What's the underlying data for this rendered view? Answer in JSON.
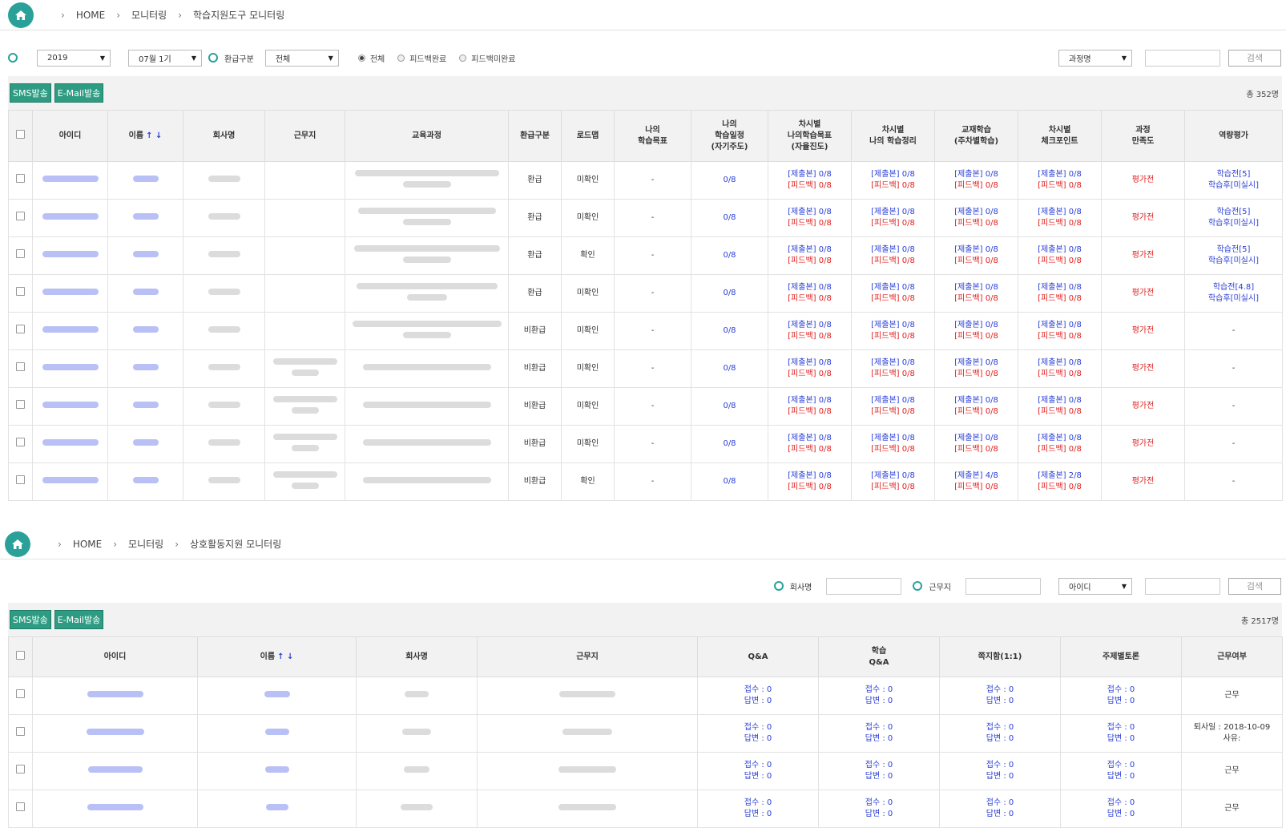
{
  "section1": {
    "breadcrumb": [
      "HOME",
      "모니터링",
      "학습지원도구 모니터링"
    ],
    "filters": {
      "year": "2019",
      "period": "07월 1기",
      "refund_label": "환급구분",
      "refund_value": "전체",
      "radios": [
        "전체",
        "피드백완료",
        "피드백미완료"
      ],
      "search_field": "과정명",
      "search_button": "검색"
    },
    "buttons": {
      "sms": "SMS발송",
      "email": "E-Mail발송"
    },
    "total": "총 352명",
    "columns": [
      "아이디",
      "이름",
      "회사명",
      "근무지",
      "교육과정",
      "환급구분",
      "로드맵",
      "나의\n학습목표",
      "나의\n학습일정\n(자기주도)",
      "차시별\n나의학습목표\n(자율진도)",
      "차시별\n나의 학습정리",
      "교재학습\n(주차별학습)",
      "차시별\n체크포인트",
      "과정\n만족도",
      "역량평가"
    ],
    "sort_icons": "↑ ↓",
    "rows": [
      {
        "refund": "환급",
        "roadmap": "미확인",
        "goal": "-",
        "schedule": "0/8",
        "c1": [
          "[제출본] 0/8",
          "[피드백] 0/8"
        ],
        "c2": [
          "[제출본] 0/8",
          "[피드백] 0/8"
        ],
        "c3": [
          "[제출본] 0/8",
          "[피드백] 0/8"
        ],
        "c4": [
          "[제출본] 0/8",
          "[피드백] 0/8"
        ],
        "satisfaction": "평가전",
        "eval": [
          "학습전[5]",
          "학습후[미실시]"
        ]
      },
      {
        "refund": "환급",
        "roadmap": "미확인",
        "goal": "-",
        "schedule": "0/8",
        "c1": [
          "[제출본] 0/8",
          "[피드백] 0/8"
        ],
        "c2": [
          "[제출본] 0/8",
          "[피드백] 0/8"
        ],
        "c3": [
          "[제출본] 0/8",
          "[피드백] 0/8"
        ],
        "c4": [
          "[제출본] 0/8",
          "[피드백] 0/8"
        ],
        "satisfaction": "평가전",
        "eval": [
          "학습전[5]",
          "학습후[미실시]"
        ]
      },
      {
        "refund": "환급",
        "roadmap": "확인",
        "goal": "-",
        "schedule": "0/8",
        "c1": [
          "[제출본] 0/8",
          "[피드백] 0/8"
        ],
        "c2": [
          "[제출본] 0/8",
          "[피드백] 0/8"
        ],
        "c3": [
          "[제출본] 0/8",
          "[피드백] 0/8"
        ],
        "c4": [
          "[제출본] 0/8",
          "[피드백] 0/8"
        ],
        "satisfaction": "평가전",
        "eval": [
          "학습전[5]",
          "학습후[미실시]"
        ]
      },
      {
        "refund": "환급",
        "roadmap": "미확인",
        "goal": "-",
        "schedule": "0/8",
        "c1": [
          "[제출본] 0/8",
          "[피드백] 0/8"
        ],
        "c2": [
          "[제출본] 0/8",
          "[피드백] 0/8"
        ],
        "c3": [
          "[제출본] 0/8",
          "[피드백] 0/8"
        ],
        "c4": [
          "[제출본] 0/8",
          "[피드백] 0/8"
        ],
        "satisfaction": "평가전",
        "eval": [
          "학습전[4.8]",
          "학습후[미실시]"
        ]
      },
      {
        "refund": "비환급",
        "roadmap": "미확인",
        "goal": "-",
        "schedule": "0/8",
        "c1": [
          "[제출본] 0/8",
          "[피드백] 0/8"
        ],
        "c2": [
          "[제출본] 0/8",
          "[피드백] 0/8"
        ],
        "c3": [
          "[제출본] 0/8",
          "[피드백] 0/8"
        ],
        "c4": [
          "[제출본] 0/8",
          "[피드백] 0/8"
        ],
        "satisfaction": "평가전",
        "eval": [
          "-"
        ]
      },
      {
        "refund": "비환급",
        "roadmap": "미확인",
        "goal": "-",
        "schedule": "0/8",
        "c1": [
          "[제출본] 0/8",
          "[피드백] 0/8"
        ],
        "c2": [
          "[제출본] 0/8",
          "[피드백] 0/8"
        ],
        "c3": [
          "[제출본] 0/8",
          "[피드백] 0/8"
        ],
        "c4": [
          "[제출본] 0/8",
          "[피드백] 0/8"
        ],
        "satisfaction": "평가전",
        "eval": [
          "-"
        ]
      },
      {
        "refund": "비환급",
        "roadmap": "미확인",
        "goal": "-",
        "schedule": "0/8",
        "c1": [
          "[제출본] 0/8",
          "[피드백] 0/8"
        ],
        "c2": [
          "[제출본] 0/8",
          "[피드백] 0/8"
        ],
        "c3": [
          "[제출본] 0/8",
          "[피드백] 0/8"
        ],
        "c4": [
          "[제출본] 0/8",
          "[피드백] 0/8"
        ],
        "satisfaction": "평가전",
        "eval": [
          "-"
        ]
      },
      {
        "refund": "비환급",
        "roadmap": "미확인",
        "goal": "-",
        "schedule": "0/8",
        "c1": [
          "[제출본] 0/8",
          "[피드백] 0/8"
        ],
        "c2": [
          "[제출본] 0/8",
          "[피드백] 0/8"
        ],
        "c3": [
          "[제출본] 0/8",
          "[피드백] 0/8"
        ],
        "c4": [
          "[제출본] 0/8",
          "[피드백] 0/8"
        ],
        "satisfaction": "평가전",
        "eval": [
          "-"
        ]
      },
      {
        "refund": "비환급",
        "roadmap": "확인",
        "goal": "-",
        "schedule": "0/8",
        "c1": [
          "[제출본] 0/8",
          "[피드백] 0/8"
        ],
        "c2": [
          "[제출본] 0/8",
          "[피드백] 0/8"
        ],
        "c3": [
          "[제출본] 4/8",
          "[피드백] 0/8"
        ],
        "c4": [
          "[제출본] 2/8",
          "[피드백] 0/8"
        ],
        "satisfaction": "평가전",
        "eval": [
          "-"
        ]
      }
    ]
  },
  "section2": {
    "breadcrumb": [
      "HOME",
      "모니터링",
      "상호활동지원 모니터링"
    ],
    "filters": {
      "company_label": "회사명",
      "workplace_label": "근무지",
      "search_field": "아이디",
      "search_button": "검색"
    },
    "buttons": {
      "sms": "SMS발송",
      "email": "E-Mail발송"
    },
    "total": "총 2517명",
    "columns": [
      "아이디",
      "이름",
      "회사명",
      "근무지",
      "Q&A",
      "학습\nQ&A",
      "쪽지함(1:1)",
      "주제별토론",
      "근무여부"
    ],
    "rows": [
      {
        "qa": [
          "접수 : 0",
          "답변 : 0"
        ],
        "lqa": [
          "접수 : 0",
          "답변 : 0"
        ],
        "msg": [
          "접수 : 0",
          "답변 : 0"
        ],
        "topic": [
          "접수 : 0",
          "답변 : 0"
        ],
        "status": [
          "근무"
        ]
      },
      {
        "qa": [
          "접수 : 0",
          "답변 : 0"
        ],
        "lqa": [
          "접수 : 0",
          "답변 : 0"
        ],
        "msg": [
          "접수 : 0",
          "답변 : 0"
        ],
        "topic": [
          "접수 : 0",
          "답변 : 0"
        ],
        "status": [
          "퇴사일 : 2018-10-09",
          "사유:"
        ]
      },
      {
        "qa": [
          "접수 : 0",
          "답변 : 0"
        ],
        "lqa": [
          "접수 : 0",
          "답변 : 0"
        ],
        "msg": [
          "접수 : 0",
          "답변 : 0"
        ],
        "topic": [
          "접수 : 0",
          "답변 : 0"
        ],
        "status": [
          "근무"
        ]
      },
      {
        "qa": [
          "접수 : 0",
          "답변 : 0"
        ],
        "lqa": [
          "접수 : 0",
          "답변 : 0"
        ],
        "msg": [
          "접수 : 0",
          "답변 : 0"
        ],
        "topic": [
          "접수 : 0",
          "답변 : 0"
        ],
        "status": [
          "근무"
        ]
      }
    ]
  }
}
